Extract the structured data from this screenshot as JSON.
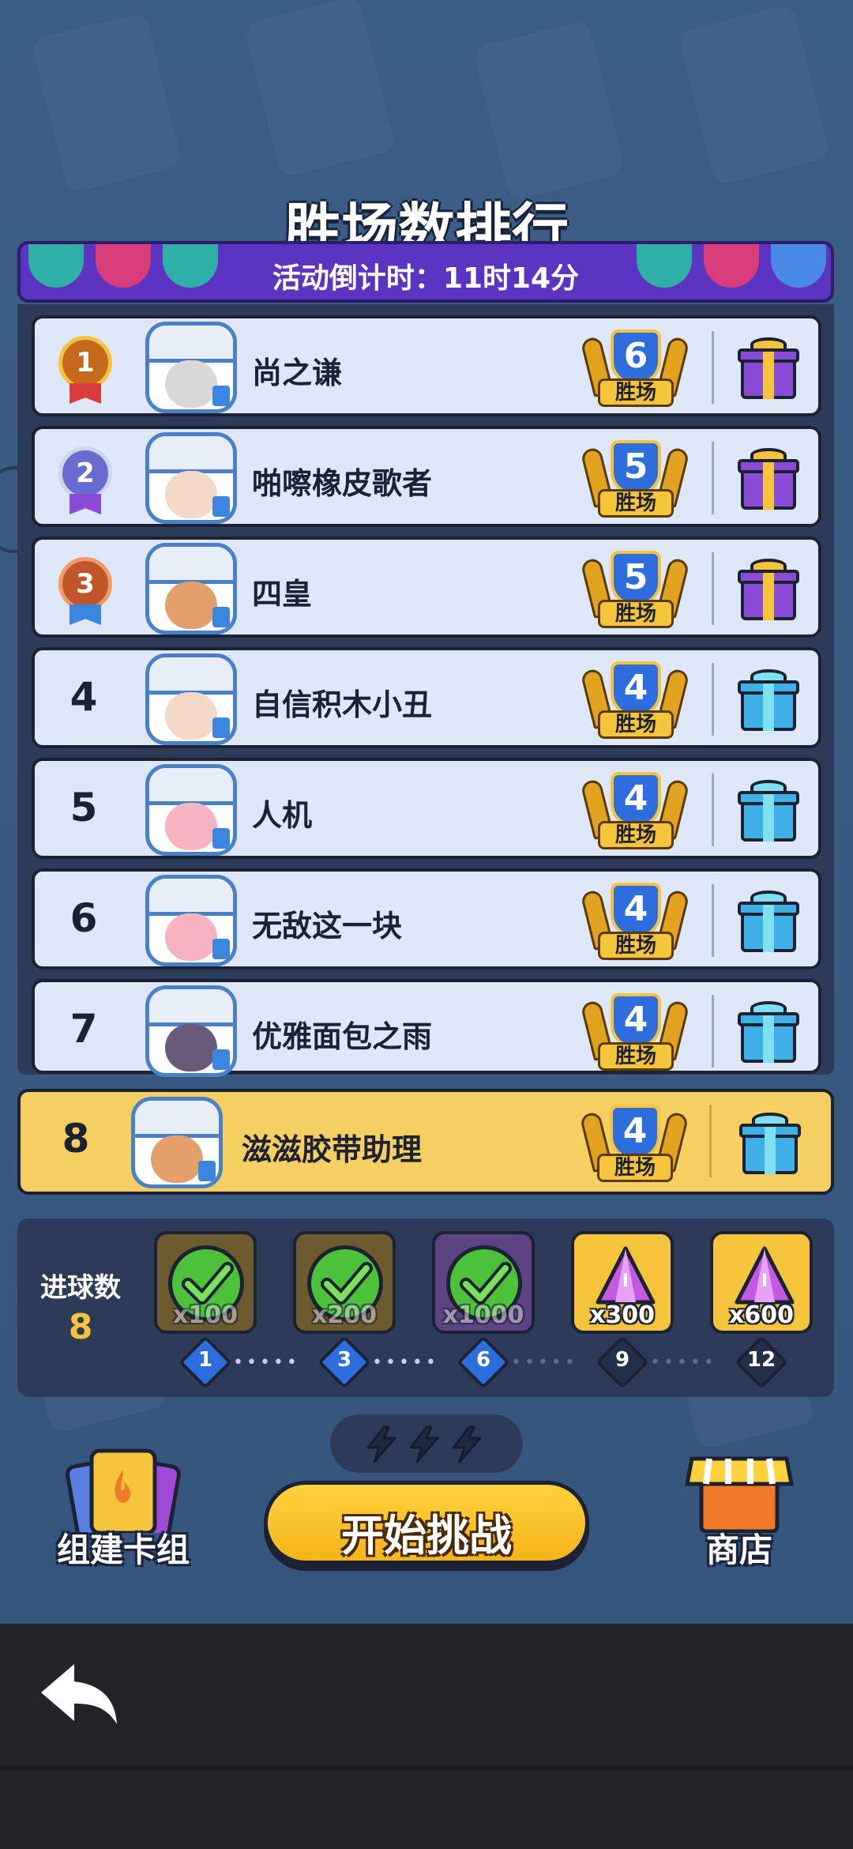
{
  "header": {
    "title": "胜场数排行",
    "countdown": "活动倒计时：11时14分"
  },
  "leaderboard": [
    {
      "rank": "1",
      "medal": "gold",
      "name": "尚之谦",
      "wins": "6",
      "wins_label": "胜场",
      "gift": "purple-gift-icon",
      "face_color": "#d8d8d8"
    },
    {
      "rank": "2",
      "medal": "silver",
      "name": "啪嚓橡皮歌者",
      "wins": "5",
      "wins_label": "胜场",
      "gift": "purple-gift-icon",
      "face_color": "#f3d9c6"
    },
    {
      "rank": "3",
      "medal": "bronze",
      "name": "四皇",
      "wins": "5",
      "wins_label": "胜场",
      "gift": "purple-gift-icon",
      "face_color": "#e3a06a"
    },
    {
      "rank": "4",
      "medal": "",
      "name": "自信积木小丑",
      "wins": "4",
      "wins_label": "胜场",
      "gift": "blue-gift-icon",
      "face_color": "#f3d9c6"
    },
    {
      "rank": "5",
      "medal": "",
      "name": "人机",
      "wins": "4",
      "wins_label": "胜场",
      "gift": "blue-gift-icon",
      "face_color": "#f7b3c2"
    },
    {
      "rank": "6",
      "medal": "",
      "name": "无敌这一块",
      "wins": "4",
      "wins_label": "胜场",
      "gift": "blue-gift-icon",
      "face_color": "#f7b3c2"
    },
    {
      "rank": "7",
      "medal": "",
      "name": "优雅面包之雨",
      "wins": "4",
      "wins_label": "胜场",
      "gift": "blue-gift-icon",
      "face_color": "#6a5a7a"
    }
  ],
  "me": {
    "rank": "8",
    "name": "滋滋胶带助理",
    "wins": "4",
    "wins_label": "胜场",
    "gift": "blue-gift-icon",
    "face_color": "#e3a06a"
  },
  "goal_rewards": {
    "title": "进球数",
    "count": "8",
    "rewards": [
      {
        "qty": "x100",
        "state": "claimed",
        "milestone": "1"
      },
      {
        "qty": "x200",
        "state": "claimed",
        "milestone": "3"
      },
      {
        "qty": "x1000",
        "state": "claimed",
        "milestone": "6"
      },
      {
        "qty": "x300",
        "state": "locked",
        "milestone": "9"
      },
      {
        "qty": "x600",
        "state": "locked",
        "milestone": "12"
      }
    ]
  },
  "energy": {
    "bolts": 3
  },
  "actions": {
    "deck_label": "组建卡组",
    "start_label": "开始挑战",
    "shop_label": "商店"
  },
  "colors": {
    "gold": "#f5c43a",
    "blue": "#2d6dde",
    "me_row": "#f5cf62",
    "gift_purple": "#8a4bd6",
    "gift_blue": "#3fb0e6"
  }
}
